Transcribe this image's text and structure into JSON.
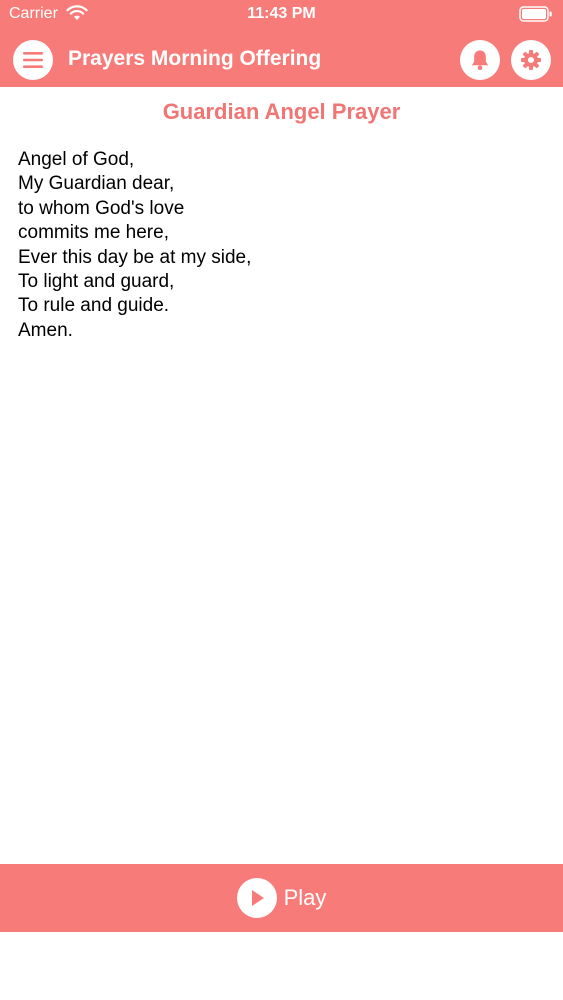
{
  "status_bar": {
    "carrier": "Carrier",
    "time": "11:43 PM",
    "wifi_icon": "wifi-icon",
    "battery_icon": "battery-icon"
  },
  "nav_bar": {
    "title": "Prayers Morning Offering",
    "menu_icon": "hamburger-menu-icon",
    "bell_icon": "bell-icon",
    "settings_icon": "gear-icon"
  },
  "prayer": {
    "title": "Guardian Angel Prayer",
    "lines": [
      "Angel of God,",
      "My Guardian dear,",
      "to whom God's love",
      "commits me here,",
      "Ever this day be at my side,",
      "To light and guard,",
      "To rule and guide.",
      "Amen."
    ]
  },
  "player": {
    "label": "Play",
    "icon": "play-icon"
  },
  "colors": {
    "accent": "#f77b79",
    "title_text": "#ef7674",
    "body_text": "#000000",
    "background": "#ffffff"
  }
}
